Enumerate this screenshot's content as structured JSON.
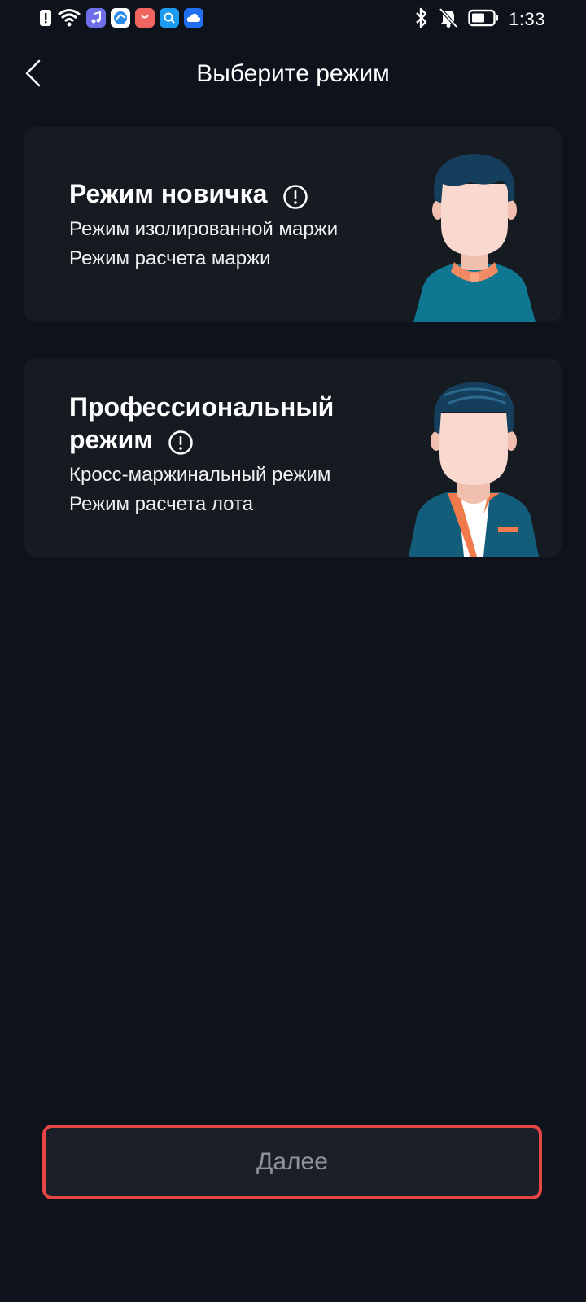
{
  "status_bar": {
    "time": "1:33",
    "left_icons": [
      "alert-icon",
      "wifi-icon",
      "music-app-icon",
      "browser-app-icon",
      "shop-app-icon",
      "search-app-icon",
      "cloud-app-icon"
    ],
    "right_icons": [
      "bluetooth-icon",
      "muted-bell-icon",
      "battery-icon"
    ]
  },
  "header": {
    "title": "Выберите режим"
  },
  "modes": [
    {
      "title": "Режим новичка",
      "lines": [
        "Режим изолированной маржи",
        "Режим расчета маржи"
      ]
    },
    {
      "title_line1": "Профессиональный",
      "title_line2": "режим",
      "lines": [
        "Кросс-маржинальный режим",
        "Режим расчета лота"
      ]
    }
  ],
  "footer": {
    "next_label": "Далее"
  },
  "colors": {
    "background": "#0e121b",
    "card": "#161b22",
    "highlight_border": "#e84545",
    "button_bg": "#1b1f29",
    "button_text": "#8f939a"
  }
}
